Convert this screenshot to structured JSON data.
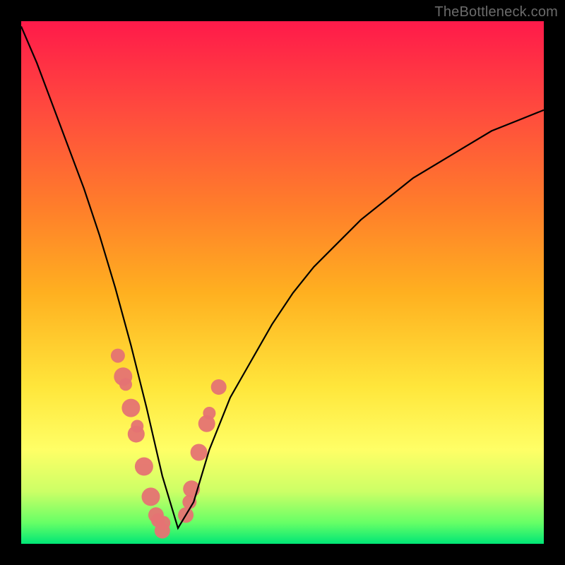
{
  "watermark": "TheBottleneck.com",
  "chart_data": {
    "type": "line",
    "title": "",
    "xlabel": "",
    "ylabel": "",
    "xlim": [
      0,
      100
    ],
    "ylim": [
      0,
      100
    ],
    "series": [
      {
        "name": "curve",
        "x": [
          0,
          3,
          6,
          9,
          12,
          15,
          18,
          21,
          24,
          27,
          30,
          33,
          36,
          40,
          44,
          48,
          52,
          56,
          60,
          65,
          70,
          75,
          80,
          85,
          90,
          95,
          100
        ],
        "values": [
          99,
          92,
          84,
          76,
          68,
          59,
          49,
          38,
          26,
          13,
          3,
          8,
          18,
          28,
          35,
          42,
          48,
          53,
          57,
          62,
          66,
          70,
          73,
          76,
          79,
          81,
          83
        ]
      }
    ],
    "dots": {
      "name": "highlight",
      "x": [
        18.5,
        19.5,
        20.0,
        21.0,
        22.0,
        22.2,
        23.5,
        24.8,
        25.8,
        26.2,
        27.0,
        27.2,
        31.5,
        32.6,
        32.2,
        34.0,
        35.5,
        36.0,
        37.8
      ],
      "values": [
        36.0,
        32.0,
        30.5,
        26.0,
        21.0,
        22.5,
        14.8,
        9.0,
        5.5,
        4.5,
        2.5,
        4.0,
        5.5,
        10.5,
        8.0,
        17.5,
        23.0,
        25.0,
        30.0
      ],
      "r": [
        10,
        13,
        9,
        13,
        12,
        9,
        13,
        13,
        11,
        10,
        11,
        10,
        11,
        12,
        10,
        12,
        12,
        9,
        11
      ]
    },
    "background": {
      "gradient_stops": [
        {
          "pos": 0,
          "color": "#ff1a4a"
        },
        {
          "pos": 18,
          "color": "#ff4d3d"
        },
        {
          "pos": 36,
          "color": "#ff7f2a"
        },
        {
          "pos": 52,
          "color": "#ffb020"
        },
        {
          "pos": 70,
          "color": "#ffe63b"
        },
        {
          "pos": 82,
          "color": "#ffff66"
        },
        {
          "pos": 90,
          "color": "#ccff66"
        },
        {
          "pos": 96,
          "color": "#66ff66"
        },
        {
          "pos": 100,
          "color": "#00e676"
        }
      ]
    }
  }
}
